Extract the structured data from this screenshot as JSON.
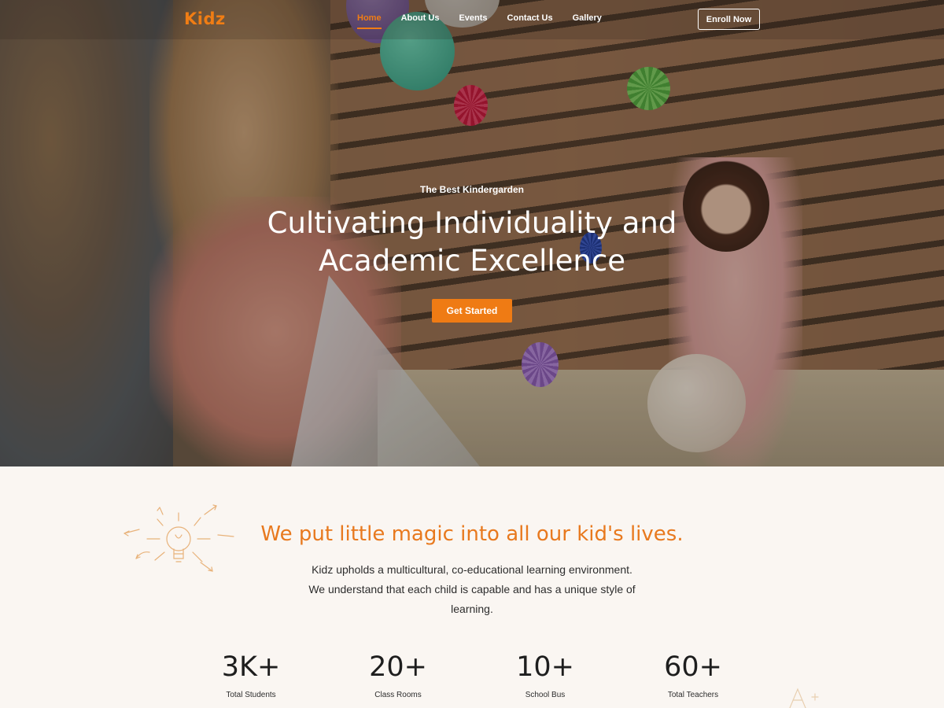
{
  "nav": {
    "logo": "Kidz",
    "links": [
      "Home",
      "About Us",
      "Events",
      "Contact Us",
      "Gallery"
    ],
    "active": "Home",
    "enroll_label": "Enroll Now"
  },
  "hero": {
    "subtitle": "The Best Kindergarden",
    "title": "Cultivating Individuality and Academic Excellence",
    "cta_label": "Get Started"
  },
  "magic": {
    "title": "We put little magic into all our kid's lives.",
    "description": "Kidz upholds a multicultural, co-educational learning environment. We understand that each child is capable and has a unique style of learning."
  },
  "stats": [
    {
      "value": "3K+",
      "label": "Total Students"
    },
    {
      "value": "20+",
      "label": "Class Rooms"
    },
    {
      "value": "10+",
      "label": "School Bus"
    },
    {
      "value": "60+",
      "label": "Total Teachers"
    }
  ],
  "colors": {
    "accent": "#ef7b14",
    "heading_accent": "#e8791e",
    "section_bg": "#faf6f2"
  },
  "icons": [
    "lightbulb-icon",
    "letter-a-doodle-icon"
  ]
}
